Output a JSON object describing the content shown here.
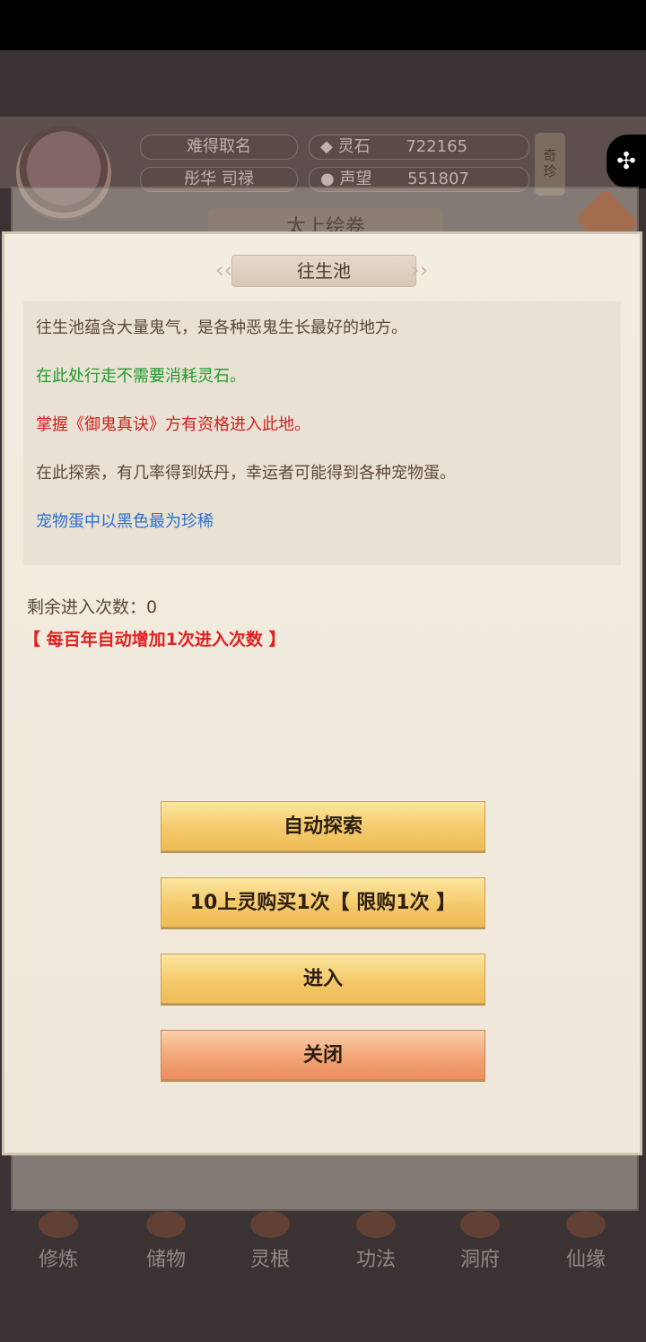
{
  "background": {
    "player_title": "难得取名",
    "player_name": "彤华 司禄",
    "lingshi_label": "灵石",
    "lingshi_value": "722165",
    "shengwang_label": "声望",
    "shengwang_value": "551807",
    "side_label": "奇珍",
    "outer_title": "太上绘卷",
    "nav": [
      "修炼",
      "储物",
      "灵根",
      "功法",
      "洞府",
      "仙缘"
    ]
  },
  "dialog": {
    "title": "往生池",
    "info_lines": [
      "往生池蕴含大量鬼气，是各种恶鬼生长最好的地方。",
      "在此处行走不需要消耗灵石。",
      "掌握《御鬼真诀》方有资格进入此地。",
      "在此探索，有几率得到妖丹，幸运者可能得到各种宠物蛋。",
      "宠物蛋中以黑色最为珍稀"
    ],
    "remaining": "剩余进入次数：0",
    "hint": "【 每百年自动增加1次进入次数 】",
    "buttons": {
      "auto": "自动探索",
      "buy": "10上灵购买1次【 限购1次 】",
      "enter": "进入",
      "close": "关闭"
    }
  },
  "colors": {
    "green_text": "#1f9a2c",
    "red_text": "#d11f1f",
    "blue_text": "#2b6fd0",
    "button_gold": "#f4c96b",
    "button_orange": "#f2a577"
  }
}
